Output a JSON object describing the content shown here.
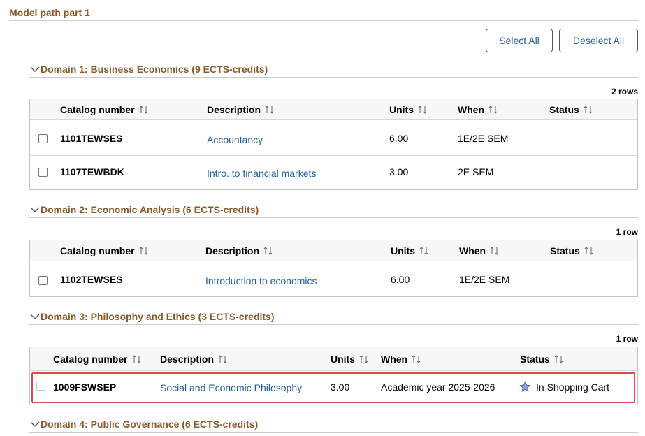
{
  "page": {
    "section_title": "Model path part 1",
    "select_all_label": "Select All",
    "deselect_all_label": "Deselect All"
  },
  "columns": {
    "catalog": "Catalog number",
    "description": "Description",
    "units": "Units",
    "when": "When",
    "status": "Status"
  },
  "domains": [
    {
      "title": "Domain 1: Business Economics (9 ECTS-credits)",
      "row_count": "2 rows",
      "rows": [
        {
          "catalog": "1101TEWSES",
          "description": "Accountancy",
          "units": "6.00",
          "when": "1E/2E SEM",
          "status": ""
        },
        {
          "catalog": "1107TEWBDK",
          "description": "Intro. to financial markets",
          "units": "3.00",
          "when": "2E SEM",
          "status": ""
        }
      ]
    },
    {
      "title": "Domain 2: Economic Analysis (6 ECTS-credits)",
      "row_count": "1 row",
      "rows": [
        {
          "catalog": "1102TEWSES",
          "description": "Introduction to economics",
          "units": "6.00",
          "when": "1E/2E SEM",
          "status": ""
        }
      ]
    },
    {
      "title": "Domain 3: Philosophy and Ethics (3 ECTS-credits)",
      "row_count": "1 row",
      "rows": [
        {
          "catalog": "1009FSWSEP",
          "description": "Social and Economic Philosophy",
          "units": "3.00",
          "when": "Academic year 2025-2026",
          "status": "In Shopping Cart"
        }
      ]
    },
    {
      "title": "Domain 4: Public Governance (6 ECTS-credits)"
    }
  ],
  "colors": {
    "heading": "#8b5a2b",
    "link": "#1f5fa6",
    "highlight": "#e0464e",
    "star": "#5b7fc4"
  }
}
